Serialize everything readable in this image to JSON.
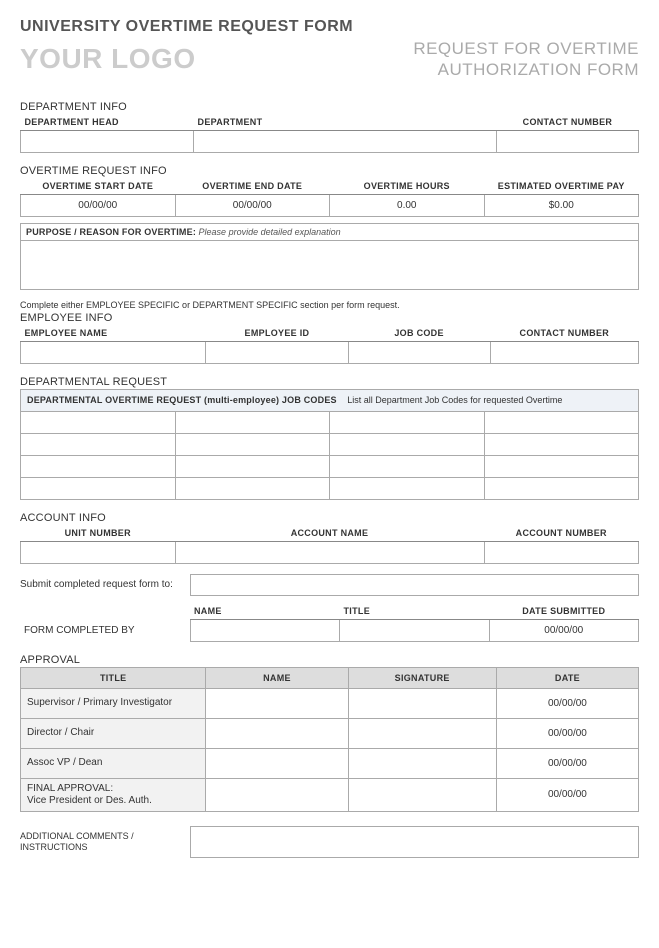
{
  "page_title": "UNIVERSITY OVERTIME REQUEST FORM",
  "logo_text": "YOUR LOGO",
  "subtitle_l1": "REQUEST FOR OVERTIME",
  "subtitle_l2": "AUTHORIZATION FORM",
  "dept_info": {
    "section": "DEPARTMENT INFO",
    "cols": [
      "DEPARTMENT HEAD",
      "DEPARTMENT",
      "CONTACT NUMBER"
    ]
  },
  "ot_req": {
    "section": "OVERTIME REQUEST INFO",
    "cols": [
      "OVERTIME START DATE",
      "OVERTIME END DATE",
      "OVERTIME HOURS",
      "ESTIMATED OVERTIME PAY"
    ],
    "vals": [
      "00/00/00",
      "00/00/00",
      "0.00",
      "$0.00"
    ]
  },
  "purpose": {
    "label": "PURPOSE / REASON FOR OVERTIME:",
    "hint": "Please provide detailed explanation"
  },
  "instruction": "Complete either EMPLOYEE SPECIFIC or DEPARTMENT SPECIFIC section per form request.",
  "emp_info": {
    "section": "EMPLOYEE INFO",
    "cols": [
      "EMPLOYEE NAME",
      "EMPLOYEE ID",
      "JOB CODE",
      "CONTACT NUMBER"
    ]
  },
  "dept_req": {
    "section": "DEPARTMENTAL REQUEST",
    "header_b": "DEPARTMENTAL OVERTIME REQUEST (multi-employee) JOB CODES",
    "header_note": "List all Department Job Codes for requested Overtime"
  },
  "account": {
    "section": "ACCOUNT INFO",
    "cols": [
      "UNIT NUMBER",
      "ACCOUNT NAME",
      "ACCOUNT NUMBER"
    ]
  },
  "submit_label": "Submit completed request form to:",
  "completed": {
    "label": "FORM COMPLETED BY",
    "cols": [
      "NAME",
      "TITLE",
      "DATE SUBMITTED"
    ],
    "date": "00/00/00"
  },
  "approval": {
    "section": "APPROVAL",
    "cols": [
      "TITLE",
      "NAME",
      "SIGNATURE",
      "DATE"
    ],
    "rows": [
      {
        "title": "Supervisor / Primary Investigator",
        "date": "00/00/00"
      },
      {
        "title": "Director / Chair",
        "date": "00/00/00"
      },
      {
        "title": "Assoc VP / Dean",
        "date": "00/00/00"
      },
      {
        "title": "FINAL APPROVAL:\nVice President or Des. Auth.",
        "date": "00/00/00"
      }
    ]
  },
  "comments_label": "ADDITIONAL COMMENTS / INSTRUCTIONS"
}
